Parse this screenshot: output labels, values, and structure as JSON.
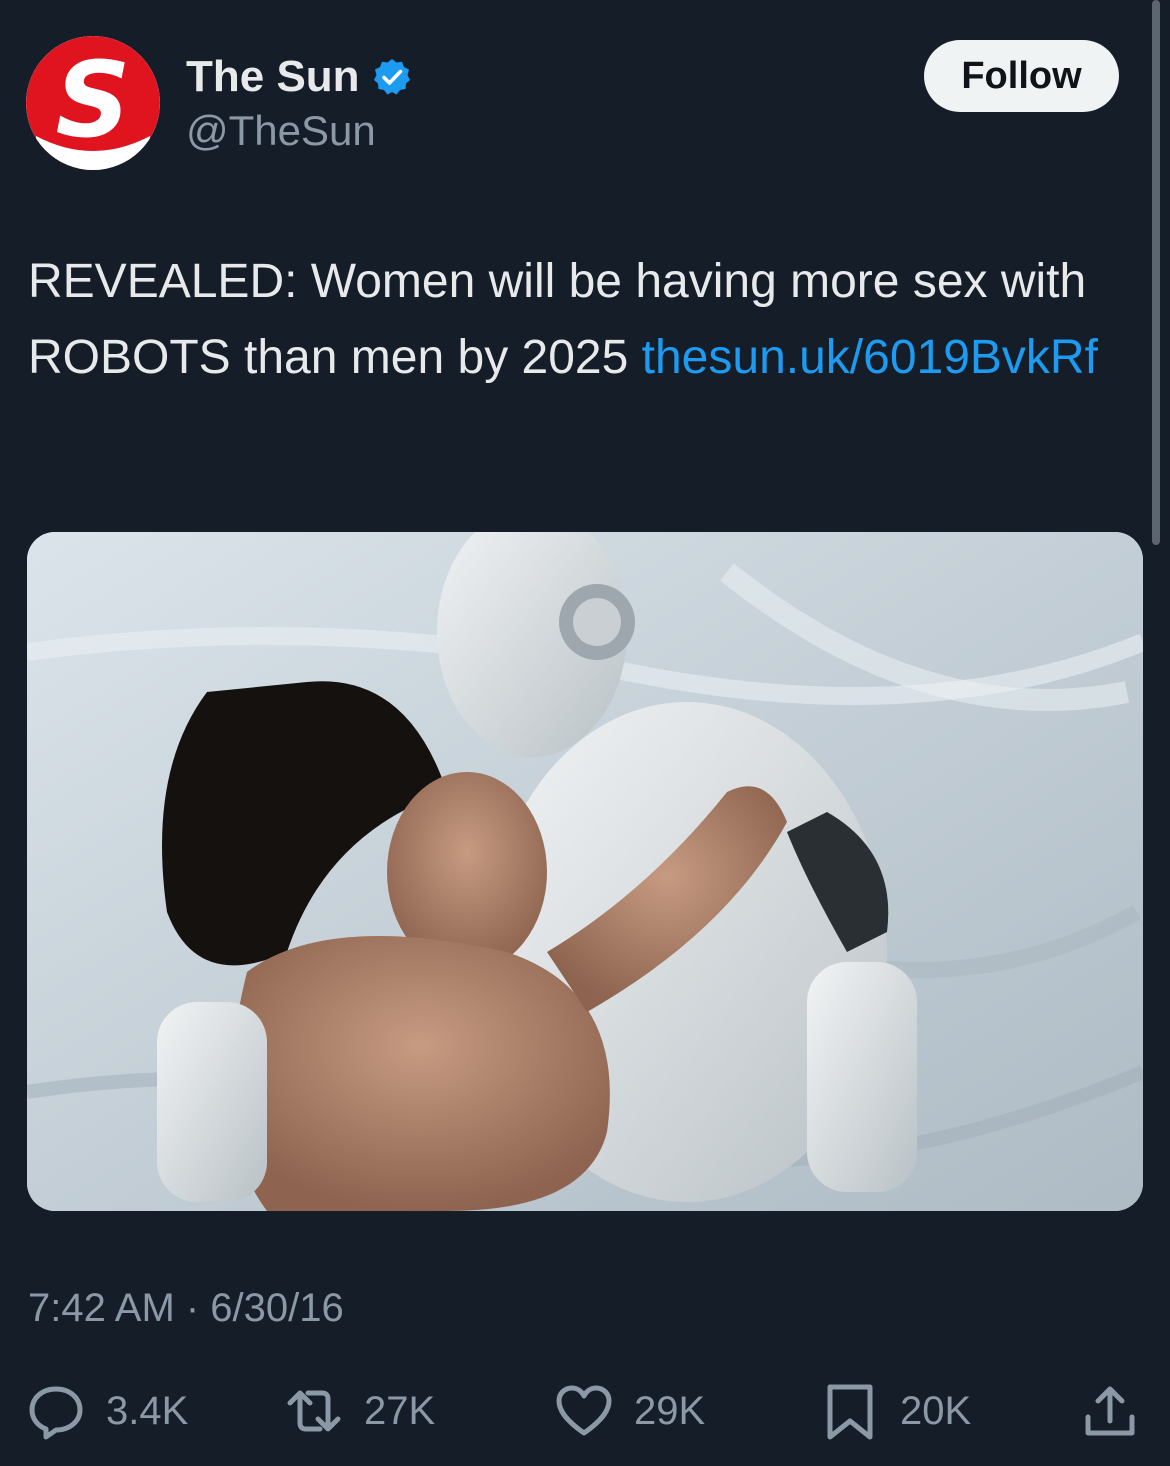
{
  "author": {
    "name": "The Sun",
    "handle": "@TheSun",
    "logo_letter": "S",
    "verified": true
  },
  "follow_label": "Follow",
  "tweet": {
    "text": "REVEALED: Women will be having more sex with ROBOTS than men by 2025 ",
    "link": "thesun.uk/6019BvkRf"
  },
  "media": {
    "kind": "photo",
    "icon": "photo-icon"
  },
  "timestamp": "7:42 AM · 6/30/16",
  "actions": {
    "replies": "3.4K",
    "reposts": "27K",
    "likes": "29K",
    "bookmarks": "20K"
  },
  "colors": {
    "background": "#151d29",
    "text": "#e7e9ea",
    "secondary": "#8b98a5",
    "link": "#1d9bf0",
    "brand_red": "#e0141e"
  }
}
